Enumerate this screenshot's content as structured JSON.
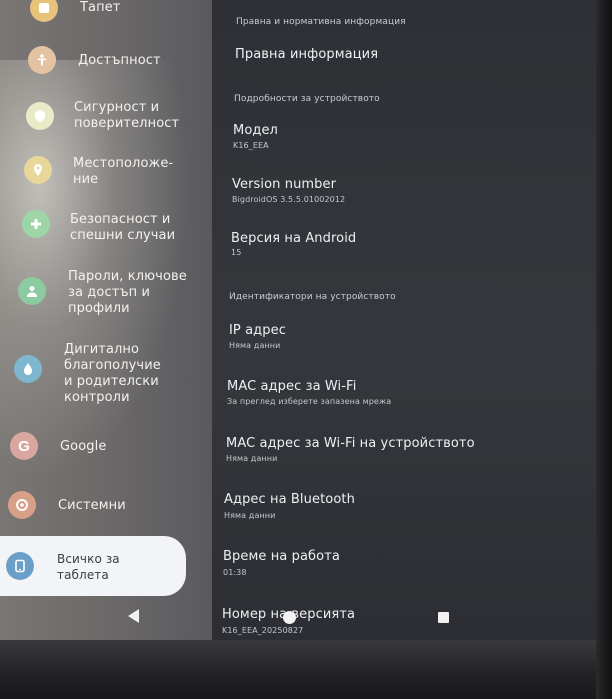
{
  "sidebar": {
    "items": [
      {
        "label": "Тапет",
        "icon": "wallpaper-icon",
        "color": "#e7c37a"
      },
      {
        "label": "Достъпност",
        "icon": "accessibility-icon",
        "color": "#e4c3a3"
      },
      {
        "label": "Сигурност и\nповерителност",
        "icon": "security-icon",
        "color": "#e9eac8"
      },
      {
        "label": "Местоположе-\nние",
        "icon": "location-icon",
        "color": "#e9d69a"
      },
      {
        "label": "Безопасност и\nспешни случаи",
        "icon": "safety-icon",
        "color": "#9fd6a7"
      },
      {
        "label": "Пароли, ключове\nза достъп и\nпрофили",
        "icon": "account-icon",
        "color": "#8ccaa0"
      },
      {
        "label": "Дигитално\nблагополучие\nи родителски\nконтроли",
        "icon": "wellbeing-icon",
        "color": "#7fb6cf"
      },
      {
        "label": "Google",
        "icon": "google-icon",
        "color": "#d9a7a0"
      },
      {
        "label": "Системни",
        "icon": "system-icon",
        "color": "#d8a088"
      },
      {
        "label": "Всичко за\nтаблета",
        "icon": "tablet-icon",
        "color": "#6c9fc8"
      }
    ]
  },
  "main": {
    "legal_header": "Правна и нормативна информация",
    "legal_info": "Правна информация",
    "device_details_header": "Подробности за устройството",
    "model_title": "Модел",
    "model_value": "K16_EEA",
    "version_title": "Version number",
    "version_value": "BigdroidOS 3.5.5.01002012",
    "android_title": "Версия на Android",
    "android_value": "15",
    "identifiers_header": "Идентификатори на устройството",
    "ip_title": "IP адрес",
    "ip_value": "Няма данни",
    "wifi_mac_title": "MAC адрес за Wi-Fi",
    "wifi_mac_value": "За преглед изберете запазена мрежа",
    "device_mac_title": "MAC адрес за Wi-Fi на устройството",
    "device_mac_value": "Няма данни",
    "bt_title": "Адрес на Bluetooth",
    "bt_value": "Няма данни",
    "uptime_title": "Време на работа",
    "uptime_value": "01:38",
    "build_title": "Номер на версията",
    "build_value": "K16_EEA_20250827"
  }
}
